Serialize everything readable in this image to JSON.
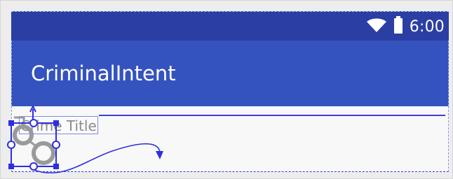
{
  "status_bar": {
    "time": "6:00",
    "icons": [
      "wifi-icon",
      "battery-icon"
    ]
  },
  "app_bar": {
    "title": "CriminalIntent"
  },
  "crime_form": {
    "title_field": {
      "value": "Crime Title",
      "placeholder": "Crime Title"
    },
    "solved_image": {
      "icon": "handcuffs-icon"
    }
  },
  "colors": {
    "status_bar": "#2a3ea3",
    "app_bar": "#3553bf",
    "selection": "#2d2fe0",
    "text_hint": "#8c8c8c"
  }
}
